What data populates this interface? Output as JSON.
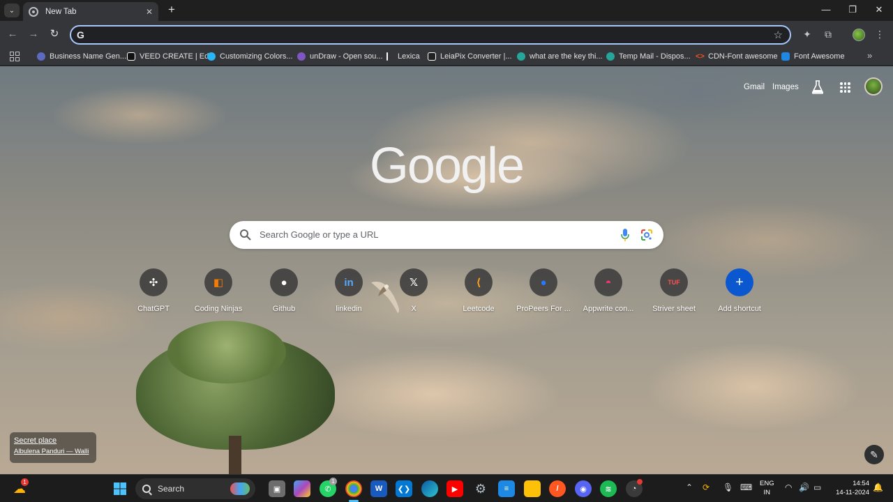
{
  "browser": {
    "tab_title": "New Tab",
    "omnibox_value": ""
  },
  "bookmarks": [
    {
      "label": "Business Name Gen...",
      "color": "#5c6bc0"
    },
    {
      "label": "VEED CREATE | Edit",
      "color": "#111111"
    },
    {
      "label": "Customizing Colors...",
      "color": "#29b6f6"
    },
    {
      "label": "unDraw - Open sou...",
      "color": "#7e57c2"
    },
    {
      "label": "Lexica",
      "color": "#ffffff"
    },
    {
      "label": "LeiaPix Converter |...",
      "color": "#222222"
    },
    {
      "label": "what are the key thi...",
      "color": "#26a69a"
    },
    {
      "label": "Temp Mail - Dispos...",
      "color": "#26a69a"
    },
    {
      "label": "CDN-Font awesome",
      "color": "#f4511e"
    },
    {
      "label": "Font Awesome",
      "color": "#1e88e5"
    }
  ],
  "ntp": {
    "gmail": "Gmail",
    "images": "Images",
    "logo": "Google",
    "search_placeholder": "Search Google or type a URL",
    "shortcuts": [
      {
        "label": "ChatGPT",
        "glyph": "✣",
        "color": "#3c3c3c"
      },
      {
        "label": "Coding Ninjas",
        "glyph": "◧",
        "color": "#f57c00"
      },
      {
        "label": "Github",
        "glyph": "●",
        "color": "#3c3c3c"
      },
      {
        "label": "linkedin",
        "glyph": "in",
        "color": "#0a66c2"
      },
      {
        "label": "X",
        "glyph": "𝕏",
        "color": "#3c3c3c"
      },
      {
        "label": "Leetcode",
        "glyph": "⟨",
        "color": "#ffa116"
      },
      {
        "label": "ProPeers For ...",
        "glyph": "●",
        "color": "#2979ff"
      },
      {
        "label": "Appwrite con...",
        "glyph": "◓",
        "color": "#fd366e"
      },
      {
        "label": "Striver sheet",
        "glyph": "TUF",
        "color": "#e53935"
      },
      {
        "label": "Add shortcut",
        "glyph": "+",
        "color": "#0b57d0"
      }
    ],
    "credit_title": "Secret place",
    "credit_author": "Albulena Panduri — Walli"
  },
  "taskbar": {
    "search_label": "Search",
    "widget_badge": "1",
    "whatsapp_badge": "1",
    "lang_line1": "ENG",
    "lang_line2": "IN",
    "time": "14:54",
    "date": "14-11-2024"
  }
}
